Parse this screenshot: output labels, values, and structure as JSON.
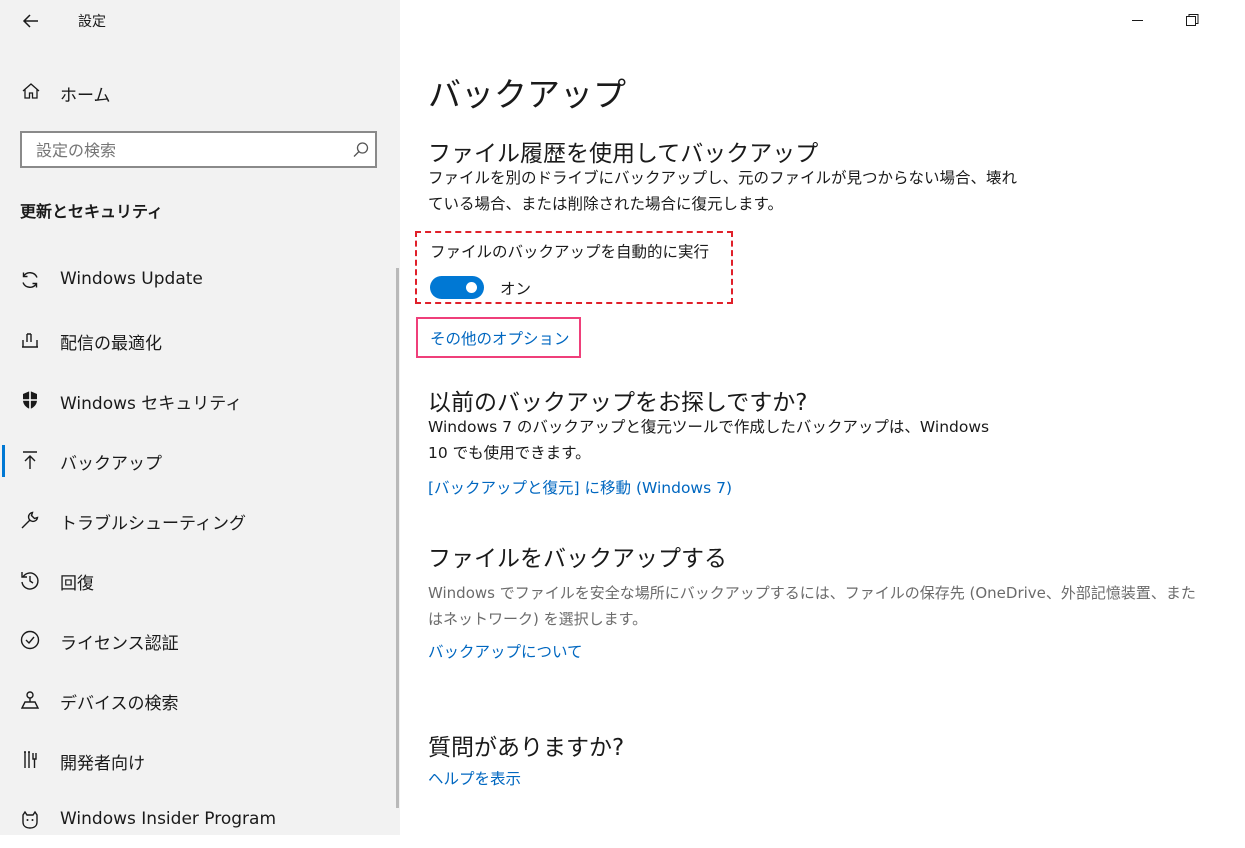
{
  "window": {
    "back_icon": "back-arrow-icon",
    "title": "設定",
    "minimize_icon": "minimize-icon",
    "restore_icon": "restore-icon"
  },
  "sidebar": {
    "home_label": "ホーム",
    "search_placeholder": "設定の検索",
    "section_title": "更新とセキュリティ",
    "items": [
      {
        "label": "Windows Update",
        "icon": "sync-icon"
      },
      {
        "label": "配信の最適化",
        "icon": "delivery-optimization-icon"
      },
      {
        "label": "Windows セキュリティ",
        "icon": "shield-icon"
      },
      {
        "label": "バックアップ",
        "icon": "backup-arrow-icon",
        "selected": true
      },
      {
        "label": "トラブルシューティング",
        "icon": "wrench-icon"
      },
      {
        "label": "回復",
        "icon": "recovery-icon"
      },
      {
        "label": "ライセンス認証",
        "icon": "check-circle-icon"
      },
      {
        "label": "デバイスの検索",
        "icon": "find-device-icon"
      },
      {
        "label": "開発者向け",
        "icon": "developer-tools-icon"
      },
      {
        "label": "Windows Insider Program",
        "icon": "insider-cat-icon"
      }
    ]
  },
  "main": {
    "page_title": "バックアップ",
    "file_history": {
      "heading": "ファイル履歴を使用してバックアップ",
      "desc_line1": "ファイルを別のドライブにバックアップし、元のファイルが見つからない場合、壊れ",
      "desc_line2": "ている場合、または削除された場合に復元します。",
      "toggle_label": "ファイルのバックアップを自動的に実行",
      "toggle_state": "オン",
      "toggle_on": true,
      "more_options_link": "その他のオプション"
    },
    "old_backup": {
      "heading": "以前のバックアップをお探しですか?",
      "desc_line1": "Windows 7 のバックアップと復元ツールで作成したバックアップは、Windows",
      "desc_line2": "10 でも使用できます。",
      "link": "[バックアップと復元] に移動 (Windows 7)"
    },
    "backup_files": {
      "heading": "ファイルをバックアップする",
      "desc_line1": "Windows でファイルを安全な場所にバックアップするには、ファイルの保存先 (OneDrive、外部記憶装置、また",
      "desc_line2": "はネットワーク) を選択します。",
      "link": "バックアップについて"
    },
    "questions": {
      "heading": "質問がありますか?",
      "link": "ヘルプを表示"
    }
  },
  "colors": {
    "accent": "#0078d4",
    "link": "#0067c0",
    "highlight_red": "#e0202a",
    "highlight_pink": "#ef3f7a",
    "sidebar_bg": "#f2f2f2"
  }
}
